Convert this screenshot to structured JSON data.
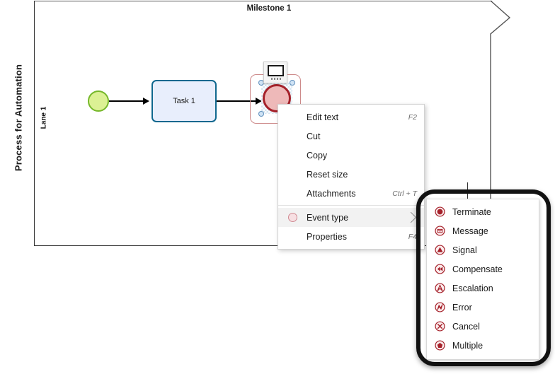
{
  "diagram": {
    "pool_title": "Process for Automation",
    "lane_title": "Lane 1",
    "milestone_label": "Milestone 1",
    "nodes": {
      "start_event": {
        "name": "start-event",
        "fill": "#dcf194",
        "stroke": "#76b82a"
      },
      "task": {
        "label": "Task 1",
        "fill": "#e8eefc",
        "stroke": "#10688f"
      },
      "end_event": {
        "name": "end-event-selected",
        "fill": "#eeb9b9",
        "stroke": "#a5212a"
      }
    }
  },
  "context_menu": {
    "items": [
      {
        "label": "Edit text",
        "accel": "F2",
        "icon": "",
        "submenu": false,
        "selected": false
      },
      {
        "label": "Cut",
        "accel": "",
        "icon": "",
        "submenu": false,
        "selected": false
      },
      {
        "label": "Copy",
        "accel": "",
        "icon": "",
        "submenu": false,
        "selected": false
      },
      {
        "label": "Reset size",
        "accel": "",
        "icon": "",
        "submenu": false,
        "selected": false
      },
      {
        "label": "Attachments",
        "accel": "Ctrl + T",
        "icon": "",
        "submenu": false,
        "selected": false
      },
      {
        "label": "Event type",
        "accel": "",
        "icon": "ring-icon",
        "submenu": true,
        "selected": true
      },
      {
        "label": "Properties",
        "accel": "F4",
        "icon": "",
        "submenu": false,
        "selected": false
      }
    ]
  },
  "event_type_submenu": {
    "accent_color": "#a5212a",
    "items": [
      {
        "label": "Terminate",
        "icon": "terminate-icon"
      },
      {
        "label": "Message",
        "icon": "message-icon"
      },
      {
        "label": "Signal",
        "icon": "signal-icon"
      },
      {
        "label": "Compensate",
        "icon": "compensate-icon"
      },
      {
        "label": "Escalation",
        "icon": "escalation-icon"
      },
      {
        "label": "Error",
        "icon": "error-icon"
      },
      {
        "label": "Cancel",
        "icon": "cancel-icon"
      },
      {
        "label": "Multiple",
        "icon": "multiple-icon"
      }
    ]
  }
}
